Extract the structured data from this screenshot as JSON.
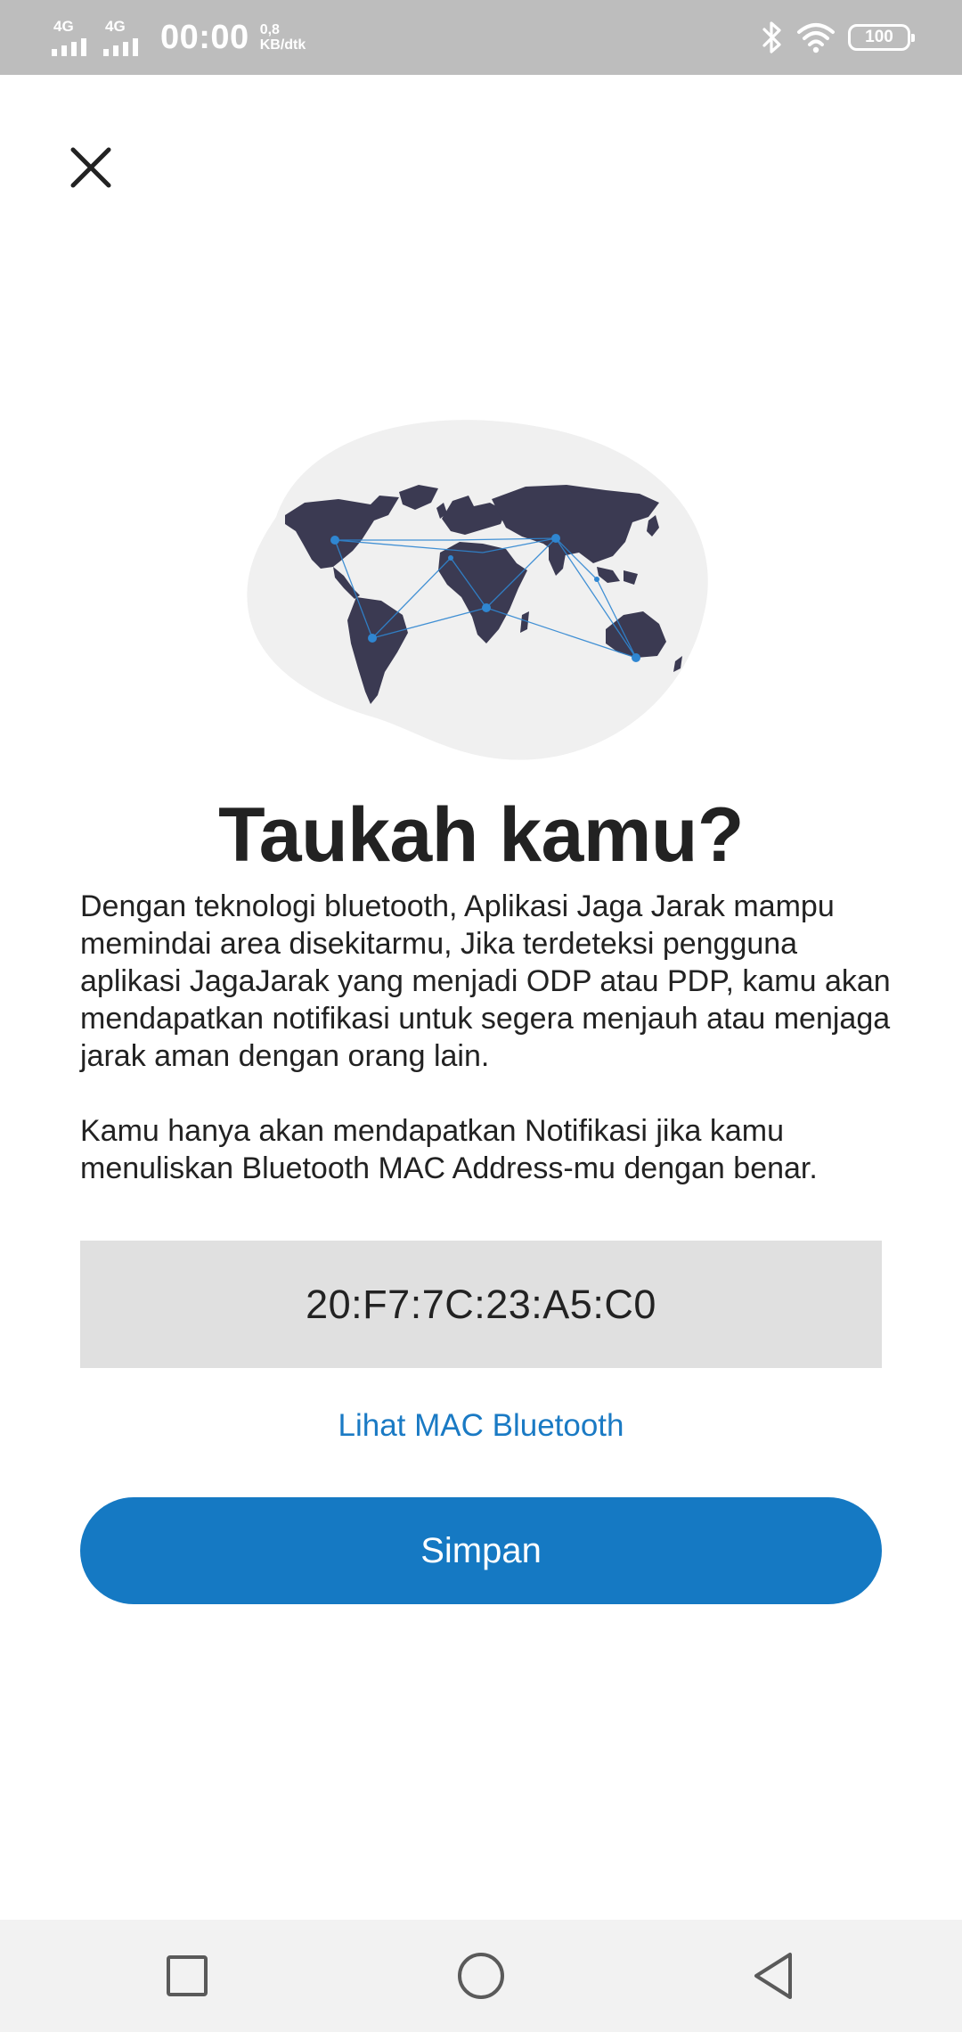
{
  "status_bar": {
    "network_1": "4G",
    "network_2": "4G",
    "time": "00:00",
    "speed_value": "0,8",
    "speed_unit": "KB/dtk",
    "battery": "100",
    "icons": [
      "signal-icon",
      "bluetooth-icon",
      "wifi-icon",
      "battery-icon"
    ]
  },
  "header": {
    "close_icon": "close-icon"
  },
  "illustration": {
    "icon": "world-map-network-illustration",
    "colors": {
      "blob": "#f0f0f0",
      "land": "#3b3a52",
      "network": "#2f86d1"
    }
  },
  "content": {
    "title": "Taukah kamu?",
    "paragraph_1": "Dengan teknologi bluetooth, Aplikasi Jaga Jarak mampu memindai area disekitarmu, Jika terdeteksi pengguna aplikasi JagaJarak yang menjadi ODP atau PDP, kamu akan mendapatkan notifikasi untuk segera menjauh atau menjaga jarak aman dengan orang lain.",
    "paragraph_2": "Kamu hanya akan mendapatkan Notifikasi jika kamu menuliskan Bluetooth MAC Address-mu dengan benar."
  },
  "form": {
    "mac_value": "20:F7:7C:23:A5:C0",
    "mac_link_label": "Lihat MAC Bluetooth",
    "save_label": "Simpan"
  },
  "nav_bar": {
    "icons": [
      "recents-square-icon",
      "home-circle-icon",
      "back-triangle-icon"
    ]
  },
  "colors": {
    "accent": "#1579c3",
    "link": "#1a7ac4",
    "status_bar": "#bdbdbd",
    "field_bg": "#e0e0e0",
    "nav_bg": "#f2f2f2"
  }
}
